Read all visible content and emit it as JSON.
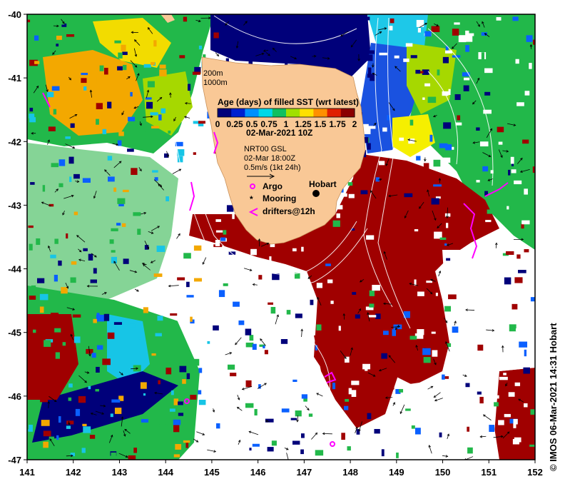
{
  "map": {
    "x_ticks": [
      "141",
      "142",
      "143",
      "144",
      "145",
      "146",
      "147",
      "148",
      "149",
      "150",
      "151",
      "152"
    ],
    "y_ticks": [
      "-40",
      "-41",
      "-42",
      "-43",
      "-44",
      "-45",
      "-46",
      "-47"
    ],
    "contours": [
      "200m",
      "1000m"
    ],
    "colorbar": {
      "title": "Age (days) of filled SST (wrt latest)",
      "tick_labels": [
        "0",
        "0.25",
        "0.5",
        "0.75",
        "1",
        "1.25",
        "1.5",
        "1.75",
        "2"
      ],
      "colors": [
        "#00007a",
        "#0020d0",
        "#0090ff",
        "#00d8e8",
        "#10c060",
        "#a0e000",
        "#ffe000",
        "#ff9000",
        "#e02000",
        "#8b0000"
      ]
    },
    "date": "02-Mar-2021 10Z",
    "current_product": "NRT00 GSL",
    "current_time": "02-Mar 18:00Z",
    "scale_text": "0.5m/s (1kt 24h)",
    "legend": {
      "argo": "Argo",
      "mooring": "Mooring",
      "drifters": "drifters@12h"
    },
    "city": "Hobart",
    "credit": "© IMOS 06-Mar-2021 14:31 Hobart",
    "colors": {
      "land": "#f9c896",
      "old_sst": "#a00000",
      "drifter": "#ff00ff",
      "argo": "#ff00ff"
    }
  }
}
